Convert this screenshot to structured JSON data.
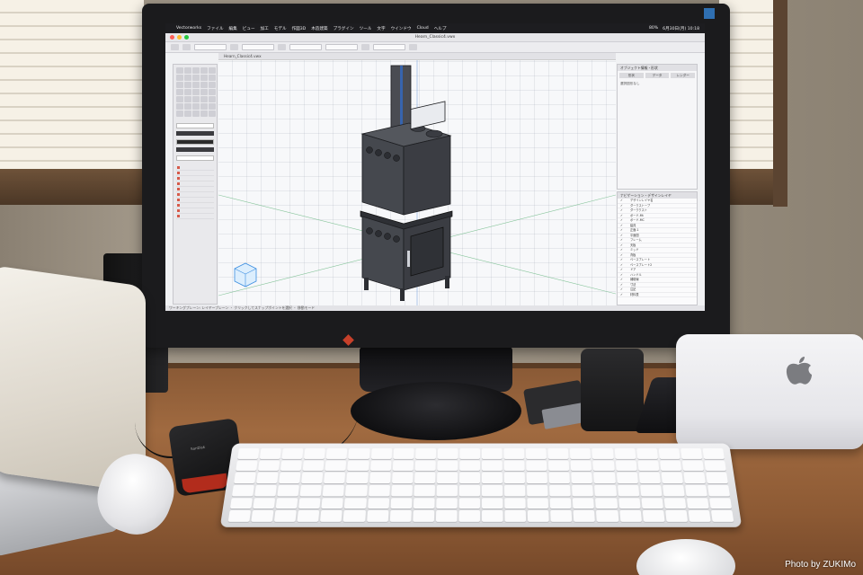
{
  "menubar": {
    "app": "Vectorworks",
    "items": [
      "ファイル",
      "編集",
      "ビュー",
      "加工",
      "モデル",
      "作図3D",
      "木造建築",
      "プラグイン",
      "ツール",
      "文字",
      "ウインドウ",
      "Cloud",
      "ヘルプ"
    ],
    "clock": "6月30日(月) 10:18",
    "battery": "80%"
  },
  "document": {
    "window_title": "Hearn_Classic4.vwx",
    "tab_label": "Hearn_Classic4.vwx"
  },
  "object_info": {
    "header": "オブジェクト情報・形状",
    "tabs": [
      "形状",
      "データ",
      "レンダー"
    ],
    "status": "選択図形なし"
  },
  "navigator": {
    "header": "ナビゲーション・デザインレイヤ",
    "rows": [
      "デザインレイヤ名",
      "ダークストーブ",
      "ダーククスト",
      "ボード-Mt",
      "ボード-MC",
      "建具",
      "正面-1",
      "平面図",
      "フレーム",
      "天板",
      "ミッド",
      "背板",
      "ベースプレート",
      "ベースプレート2",
      "ドア",
      "ハンドル",
      "補助線",
      "寸法",
      "注記",
      "材料表"
    ]
  },
  "statusbar": {
    "hint": "ワーキングプレーン: レイヤープレーン ・ クリックしてスナップポイントを選択 ・ 移動モード"
  },
  "ssd": {
    "brand": "SanDisk"
  },
  "photo_credit": "Photo by ZUKIMo",
  "colors": {
    "screen_bg": "#f1f2f4",
    "menubar": "#1d1d20",
    "stove": "#4a4c52",
    "stove_edges": "#1c1d20",
    "axis_blue": "#2f6fd6",
    "ssd_accent": "#b22c1c",
    "led_green": "#34b85d"
  }
}
